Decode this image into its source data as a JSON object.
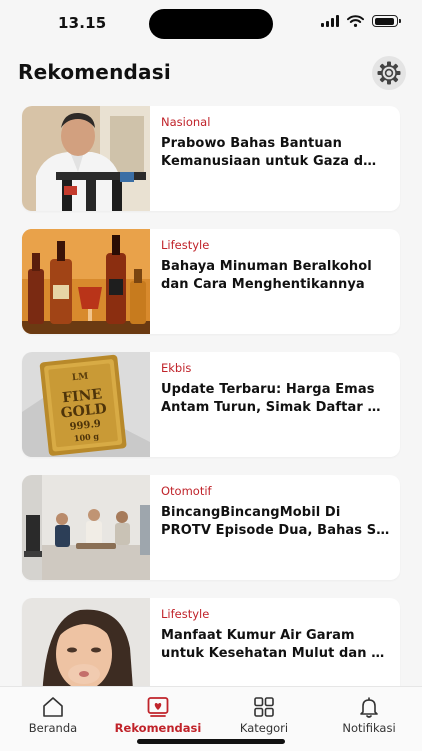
{
  "status_bar": {
    "time": "13.15"
  },
  "header": {
    "title": "Rekomendasi",
    "settings_icon": "gear-icon"
  },
  "articles": [
    {
      "category": "Nasional",
      "title": "Prabowo Bahas Bantuan Kemanusiaan untuk Gaza d…",
      "image": "press-conference-photo"
    },
    {
      "category": "Lifestyle",
      "title": "Bahaya Minuman Beralkohol dan Cara Menghentikannya",
      "image": "liquor-bottles-photo"
    },
    {
      "category": "Ekbis",
      "title": "Update Terbaru: Harga Emas Antam Turun, Simak Daftar …",
      "image": "gold-bar-photo",
      "image_text": {
        "brand": "LM",
        "line1": "FINE",
        "line2": "GOLD",
        "purity": "999.9",
        "weight": "100 g"
      }
    },
    {
      "category": "Otomotif",
      "title": "BincangBincangMobil Di PROTV Episode Dua, Bahas S…",
      "image": "talk-show-photo"
    },
    {
      "category": "Lifestyle",
      "title": "Manfaat Kumur Air Garam untuk Kesehatan Mulut dan …",
      "image": "woman-gargling-photo"
    }
  ],
  "tab_bar": {
    "active": "Rekomendasi",
    "tabs": [
      {
        "label": "Beranda",
        "icon": "home-icon"
      },
      {
        "label": "Rekomendasi",
        "icon": "recommendation-icon"
      },
      {
        "label": "Kategori",
        "icon": "grid-icon"
      },
      {
        "label": "Notifikasi",
        "icon": "bell-icon"
      }
    ]
  },
  "colors": {
    "accent": "#c0232a",
    "background": "#f6f6f6",
    "card": "#ffffff",
    "text": "#111111"
  }
}
